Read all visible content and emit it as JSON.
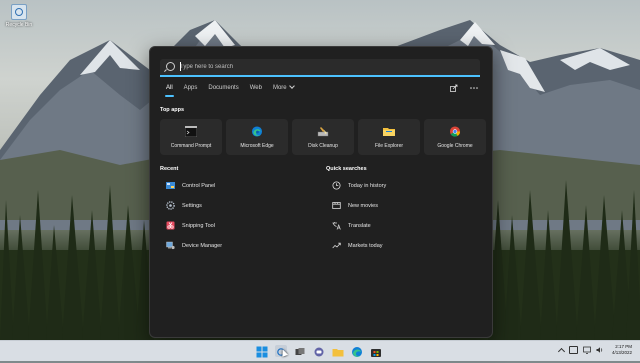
{
  "desktop": {
    "icon_label": "Recycle Bin"
  },
  "search": {
    "placeholder": "Type here to search",
    "value": ""
  },
  "tabs": [
    {
      "label": "All",
      "active": true
    },
    {
      "label": "Apps"
    },
    {
      "label": "Documents"
    },
    {
      "label": "Web"
    },
    {
      "label": "More"
    }
  ],
  "top_apps_title": "Top apps",
  "top_apps": [
    {
      "label": "Command Prompt",
      "icon": "command-prompt-icon"
    },
    {
      "label": "Microsoft Edge",
      "icon": "edge-icon"
    },
    {
      "label": "Disk Cleanup",
      "icon": "disk-cleanup-icon"
    },
    {
      "label": "File Explorer",
      "icon": "folder-icon"
    },
    {
      "label": "Google Chrome",
      "icon": "chrome-icon"
    }
  ],
  "recent_title": "Recent",
  "recent": [
    {
      "label": "Control Panel",
      "icon": "control-panel-icon"
    },
    {
      "label": "Settings",
      "icon": "gear-icon"
    },
    {
      "label": "Snipping Tool",
      "icon": "scissors-icon"
    },
    {
      "label": "Device Manager",
      "icon": "device-manager-icon"
    }
  ],
  "quick_title": "Quick searches",
  "quick": [
    {
      "label": "Today in history",
      "icon": "clock-icon"
    },
    {
      "label": "New movies",
      "icon": "movie-icon"
    },
    {
      "label": "Translate",
      "icon": "translate-icon"
    },
    {
      "label": "Markets today",
      "icon": "markets-icon"
    }
  ],
  "clock": {
    "time": "2:17 PM",
    "date": "4/13/2022"
  },
  "colors": {
    "accent": "#4cc2ff",
    "panel": "#202020",
    "tile": "#2b2b2b",
    "taskbar": "#d9dee4"
  }
}
